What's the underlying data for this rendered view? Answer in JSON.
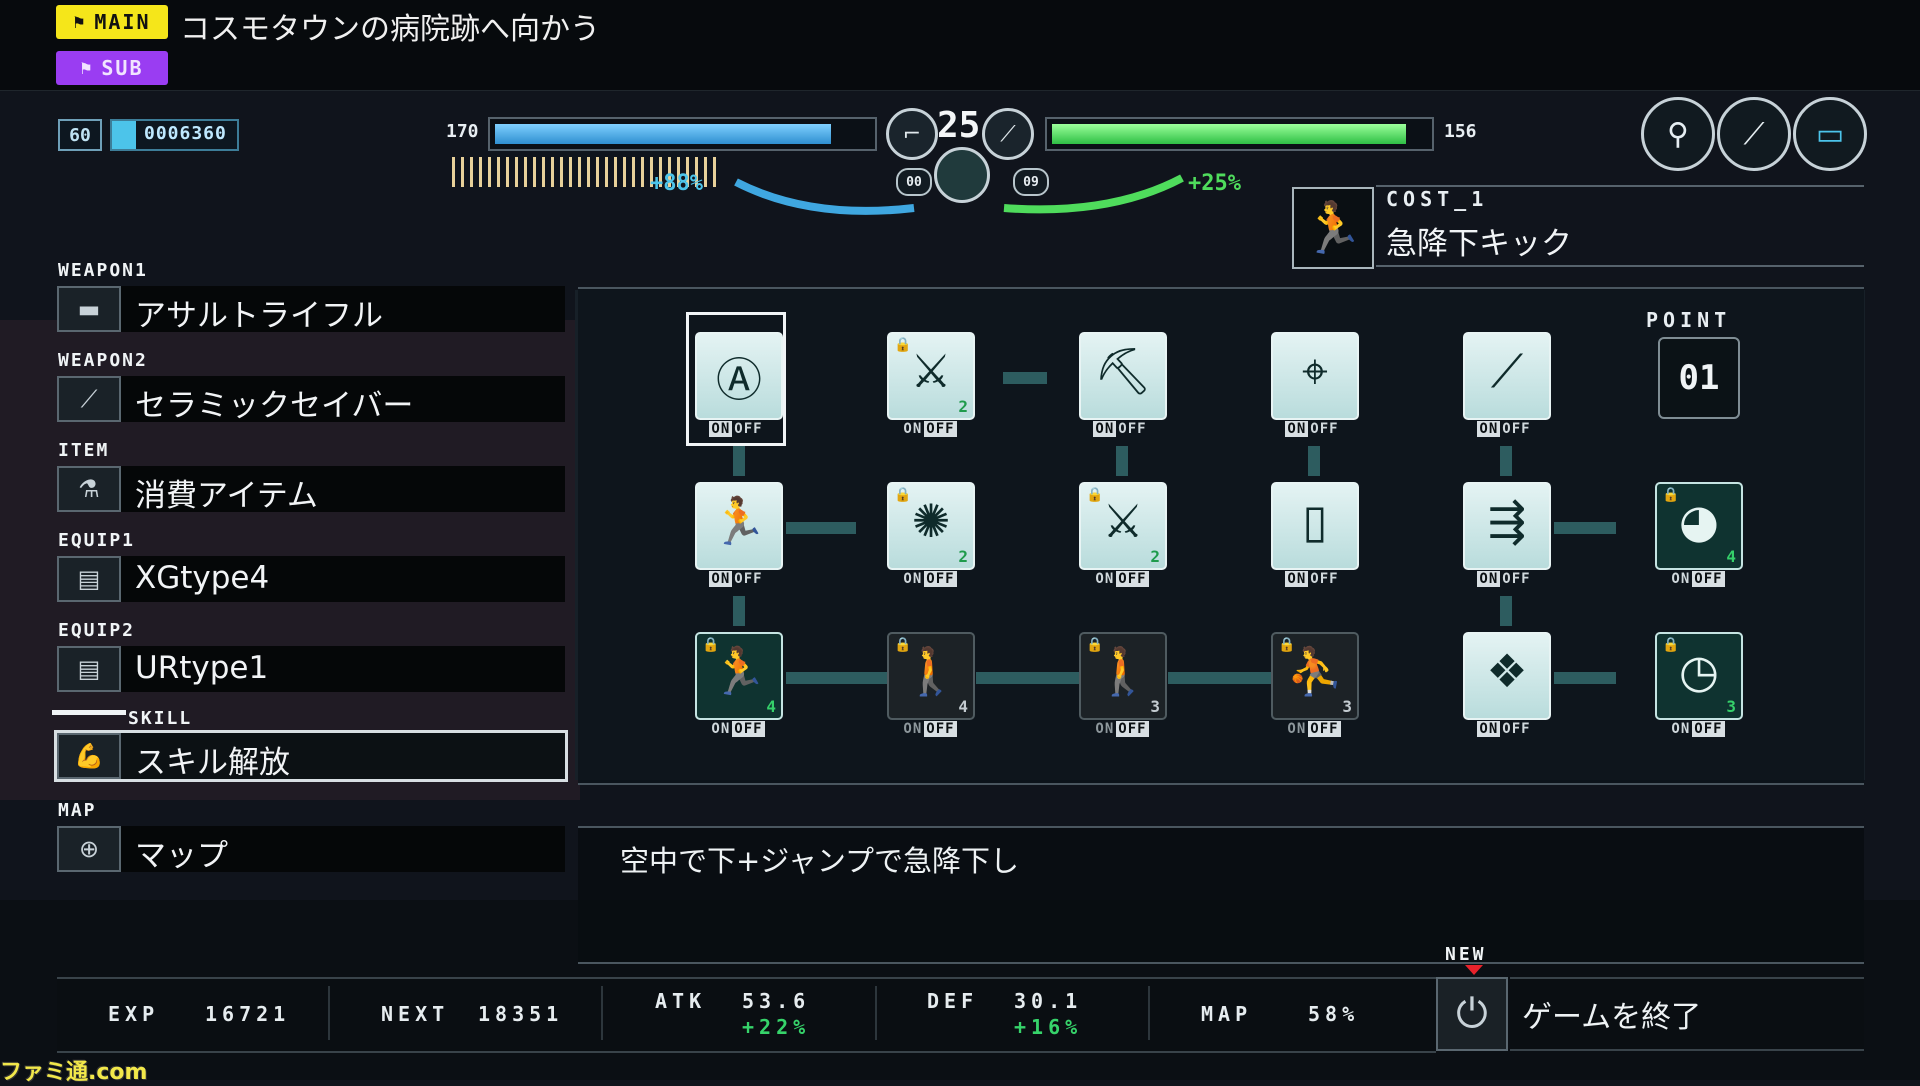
{
  "quest": {
    "main_tag": "MAIN",
    "main_text": "コスモタウンの病院跡へ向かう",
    "sub_tag": "SUB"
  },
  "status": {
    "level": "60",
    "gold": "0006360",
    "hp_left": "170",
    "hp_right": "156",
    "center_level": "25",
    "pct_left": "+88%",
    "pct_right": "+25%",
    "dial_left": "00",
    "dial_right": "09",
    "blue_bar_fraction": 0.92,
    "green_bar_fraction": 0.97
  },
  "cost": {
    "label": "COST_1",
    "name": "急降下キック"
  },
  "menu": {
    "items": [
      {
        "category": "WEAPON1",
        "label": "アサルトライフル",
        "icon": "rifle-icon"
      },
      {
        "category": "WEAPON2",
        "label": "セラミックセイバー",
        "icon": "saber-icon"
      },
      {
        "category": "ITEM",
        "label": "消費アイテム",
        "icon": "item-icon"
      },
      {
        "category": "EQUIP1",
        "label": "XGtype4",
        "icon": "equip-icon"
      },
      {
        "category": "EQUIP2",
        "label": "URtype1",
        "icon": "equip-icon"
      },
      {
        "category": "SKILL",
        "label": "スキル解放",
        "icon": "arm-icon"
      },
      {
        "category": "MAP",
        "label": "マップ",
        "icon": "map-icon"
      }
    ]
  },
  "skills": {
    "point_label": "POINT",
    "points": "01",
    "on_text": "ON",
    "off_text": "OFF"
  },
  "description": "空中で下+ジャンプで急降下し",
  "stats": {
    "exp_label": "EXP",
    "exp": "16721",
    "next_label": "NEXT",
    "next": "18351",
    "atk_label": "ATK",
    "atk": "53.6",
    "atk_bonus": "+22%",
    "def_label": "DEF",
    "def": "30.1",
    "def_bonus": "+16%",
    "map_label": "MAP",
    "map": "58%"
  },
  "quit": {
    "new_label": "NEW",
    "label": "ゲームを終了"
  },
  "watermark": "ファミ通.com",
  "colors": {
    "main_tag": "#f5e61a",
    "sub_tag": "#9a3df2",
    "hp_blue": "#3fa7e0",
    "hp_green": "#4fdc5c",
    "bonus_green": "#36d36a"
  }
}
